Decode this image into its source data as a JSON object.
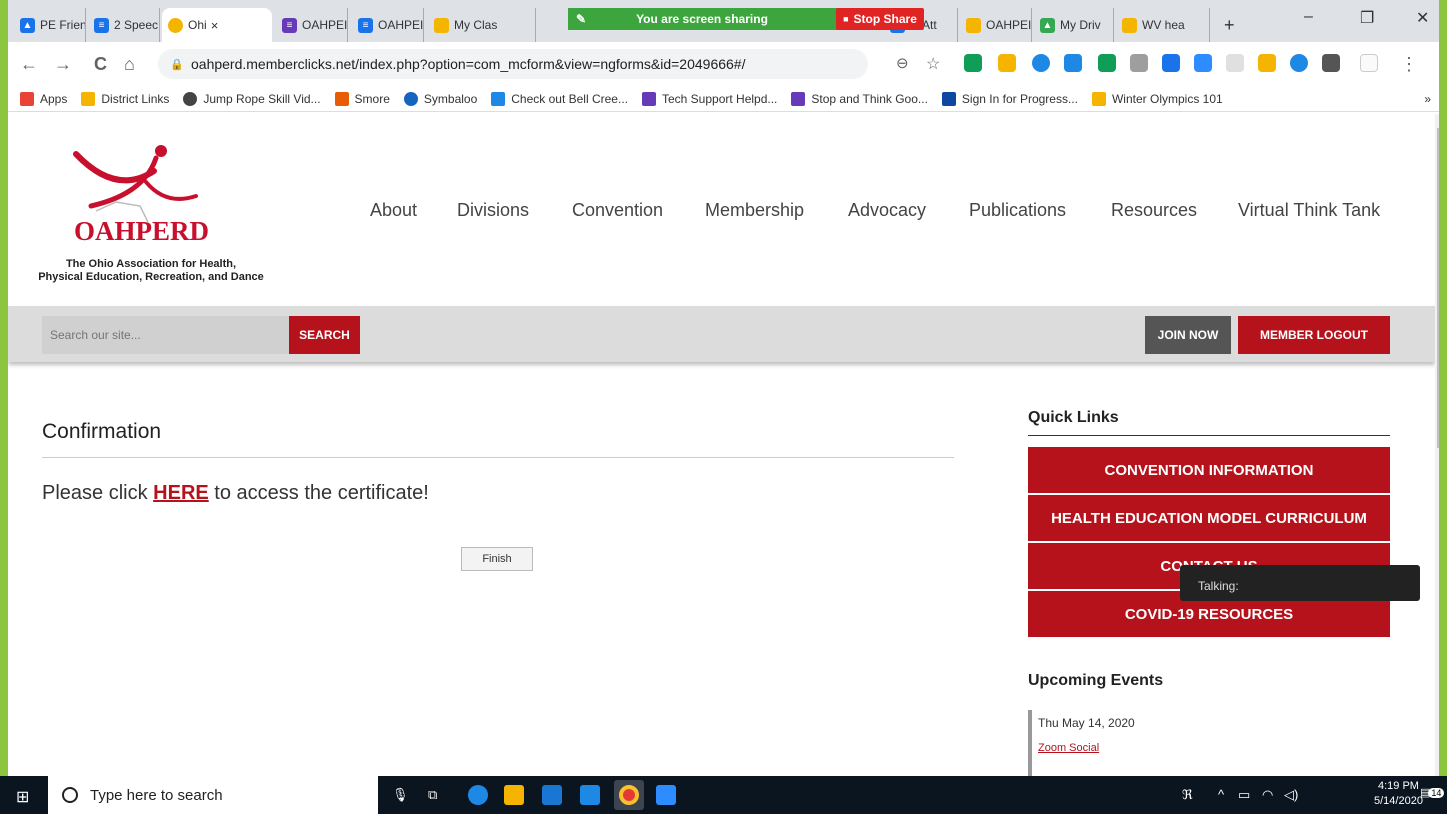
{
  "browser": {
    "tabs": [
      {
        "label": "PE Frien",
        "color": "#1a73e8"
      },
      {
        "label": "2 Speec",
        "color": "#1a73e8"
      },
      {
        "label": "Ohi",
        "color": "#f4b400",
        "active": true
      },
      {
        "label": "OAHPEI",
        "color": "#673ab7"
      },
      {
        "label": "OAHPEI",
        "color": "#1a73e8"
      },
      {
        "label": "My Clas",
        "color": "#f4b400"
      },
      {
        "label": "st Att",
        "color": "#1a73e8"
      },
      {
        "label": "OAHPEI",
        "color": "#f4b400"
      },
      {
        "label": "My Driv",
        "color": "#34a853"
      },
      {
        "label": "WV hea",
        "color": "#f4b400"
      }
    ],
    "new_tab": "+",
    "close_glyph": "×",
    "window_controls": {
      "minimize": "–",
      "restore": "❐",
      "close": "✕"
    },
    "share_banner": "You are screen sharing",
    "stop_share": "Stop Share",
    "url": "oahperd.memberclicks.net/index.php?option=com_mcform&view=ngforms&id=2049666#/",
    "nav": {
      "back": "←",
      "forward": "→",
      "reload": "C",
      "home": "⌂"
    },
    "bookmarks": [
      {
        "label": "Apps",
        "color": "#ea4335"
      },
      {
        "label": "District Links",
        "color": "#f4b400"
      },
      {
        "label": "Jump Rope Skill Vid...",
        "color": "#444"
      },
      {
        "label": "Smore",
        "color": "#e85d04"
      },
      {
        "label": "Symbaloo",
        "color": "#1565c0"
      },
      {
        "label": "Check out Bell Cree...",
        "color": "#1e88e5"
      },
      {
        "label": "Tech Support Helpd...",
        "color": "#673ab7"
      },
      {
        "label": "Stop and Think Goo...",
        "color": "#673ab7"
      },
      {
        "label": "Sign In for Progress...",
        "color": "#0d47a1"
      },
      {
        "label": "Winter Olympics 101",
        "color": "#f4b400"
      }
    ],
    "bookmarks_more": "»"
  },
  "site": {
    "logo": {
      "name": "OAHPERD",
      "subtitle_line1": "The Ohio Association for Health,",
      "subtitle_line2": "Physical Education, Recreation, and Dance"
    },
    "menu": [
      "About",
      "Divisions",
      "Convention",
      "Membership",
      "Advocacy",
      "Publications",
      "Resources",
      "Virtual Think Tank"
    ],
    "search": {
      "placeholder": "Search our site...",
      "button": "SEARCH"
    },
    "join_now": "JOIN NOW",
    "member_logout": "MEMBER LOGOUT",
    "colors": {
      "brand_red": "#b5121b",
      "frame_green": "#8cc63f"
    }
  },
  "main": {
    "title": "Confirmation",
    "message_before": "Please click ",
    "message_link": "HERE",
    "message_after": " to access the certificate!",
    "finish": "Finish"
  },
  "sidebar": {
    "quick_links_title": "Quick Links",
    "quick_links": [
      "CONVENTION INFORMATION",
      "HEALTH EDUCATION MODEL CURRICULUM",
      "CONTACT US",
      "COVID-19 RESOURCES"
    ],
    "upcoming_title": "Upcoming Events",
    "event_date": "Thu May 14, 2020",
    "event_link": "Zoom Social"
  },
  "overlay": {
    "talking": "Talking:"
  },
  "taskbar": {
    "search_placeholder": "Type here to search",
    "time": "4:19 PM",
    "date": "5/14/2020",
    "notifications": "14"
  }
}
